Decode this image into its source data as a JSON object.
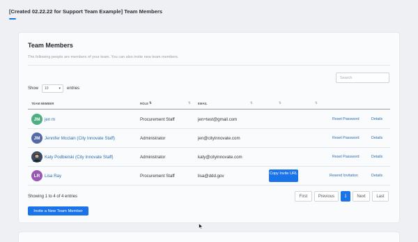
{
  "header": {
    "title": "[Created 02.22.22 for Support Team Example] Team Members",
    "accent_color": "#1a73e8"
  },
  "card": {
    "title": "Team Members",
    "subtitle": "The following people are members of your team. You can also invite new team members."
  },
  "controls": {
    "show_label": "Show",
    "entries_value": "10",
    "entries_label": "entries",
    "search_placeholder": "Search"
  },
  "table": {
    "columns": [
      "Team Member",
      "Role",
      "Email"
    ],
    "rows": [
      {
        "initials": "JM",
        "avatar_color": "#4caf82",
        "name": "jen m",
        "role": "Procurement Staff",
        "email": "jen+test@gmail.com",
        "primary_action": "Reset Password",
        "details": "Details"
      },
      {
        "initials": "JM",
        "avatar_color": "#5568a8",
        "name": "Jennifer Mcclain (City Innovate Staff)",
        "role": "Administrator",
        "email": "jen@cityinnovate.com",
        "primary_action": "Reset Password",
        "details": "Details"
      },
      {
        "initials": "",
        "avatar_color": "#3b4a5c",
        "name": "Katy Podbielski (City Innovate Staff)",
        "role": "Administrator",
        "email": "katy@cityinnovate.com",
        "primary_action": "Reset Password",
        "details": "Details"
      },
      {
        "initials": "LR",
        "avatar_color": "#9b59b6",
        "name": "Lisa Ray",
        "role": "Procurement Staff",
        "email": "lisa@ddd.gov",
        "copy_button": "Copy Invite URL",
        "primary_action": "Resend Invitation",
        "details": "Details"
      }
    ]
  },
  "footer": {
    "showing_text": "Showing 1 to 4 of 4 entries",
    "pagination": [
      "First",
      "Previous",
      "1",
      "Next",
      "Last"
    ],
    "invite_button": "Invite a New Team Member"
  }
}
